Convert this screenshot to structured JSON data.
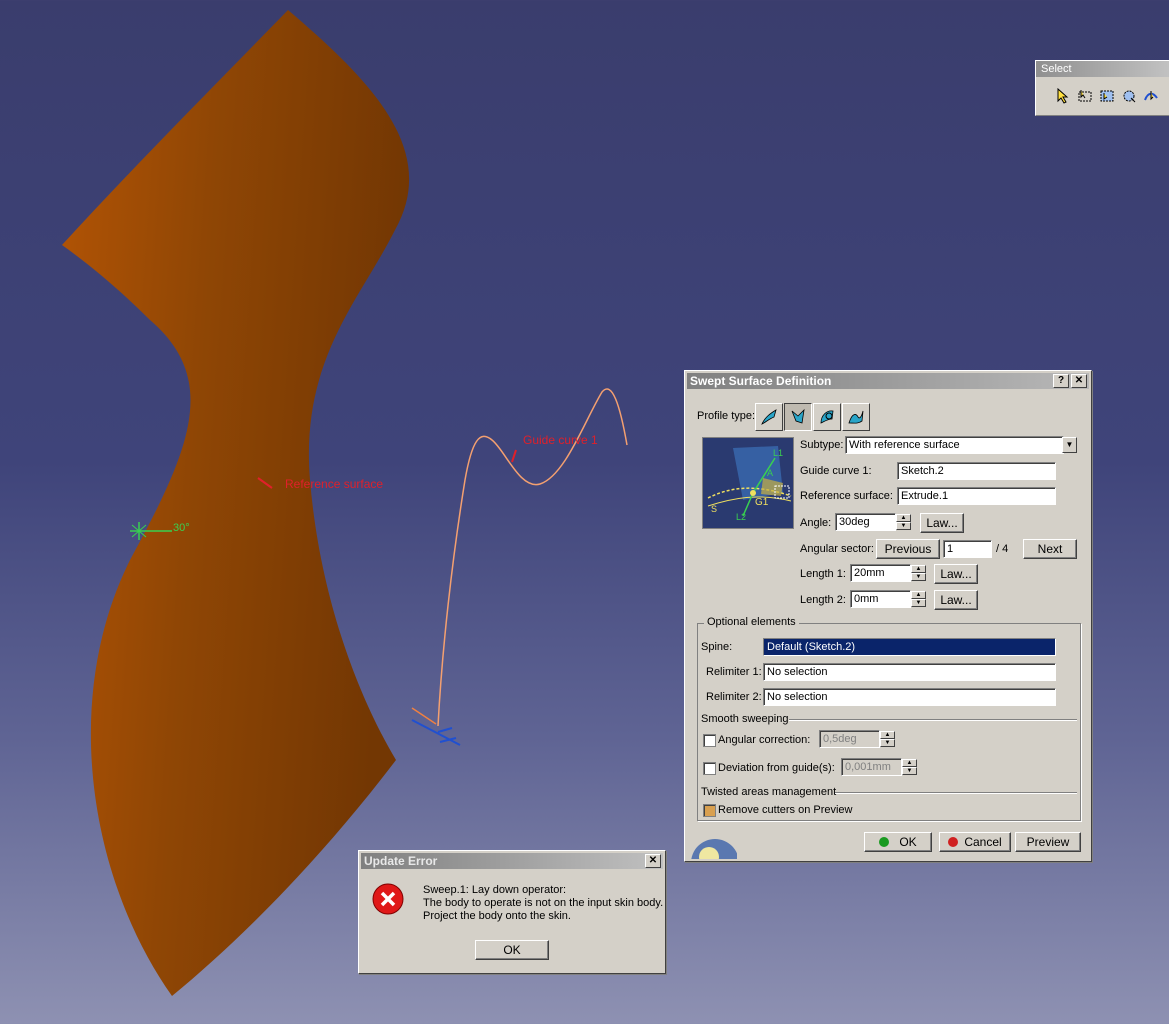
{
  "viewport": {
    "labels": {
      "reference_surface": "Reference surface",
      "guide_curve": "Guide curve 1",
      "angle": "30°"
    },
    "colors": {
      "surface": "#9a4c05",
      "curve": "#f4a070",
      "label": "#e0202a"
    }
  },
  "toolbar": {
    "title": "Select",
    "icons": [
      "select-arrow-icon",
      "select-trap-icon",
      "select-intersect-icon",
      "select-lasso-icon",
      "select-paint-icon"
    ]
  },
  "swept_dialog": {
    "title": "Swept Surface Definition",
    "profile_type_label": "Profile type:",
    "subtype_label": "Subtype:",
    "subtype_value": "With reference surface",
    "guide_curve_label": "Guide curve 1:",
    "guide_curve_value": "Sketch.2",
    "reference_surface_label": "Reference surface:",
    "reference_surface_value": "Extrude.1",
    "angle_label": "Angle:",
    "angle_value": "30deg",
    "law_label": "Law...",
    "angular_sector_label": "Angular sector:",
    "previous_label": "Previous",
    "sector_value": "1",
    "sector_total": "/ 4",
    "next_label": "Next",
    "length1_label": "Length 1:",
    "length1_value": "20mm",
    "length2_label": "Length 2:",
    "length2_value": "0mm",
    "optional_label": "Optional elements",
    "spine_label": "Spine:",
    "spine_value": "Default (Sketch.2)",
    "relimiter1_label": "Relimiter 1:",
    "relimiter1_value": "No selection",
    "relimiter2_label": "Relimiter 2:",
    "relimiter2_value": "No selection",
    "smooth_label": "Smooth sweeping",
    "angular_correction_label": "Angular correction:",
    "angular_correction_value": "0,5deg",
    "deviation_label": "Deviation from guide(s):",
    "deviation_value": "0,001mm",
    "twisted_label": "Twisted areas management",
    "remove_cutters_label": "Remove cutters on Preview",
    "ok_label": "OK",
    "cancel_label": "Cancel",
    "preview_label": "Preview",
    "diagram_labels": {
      "l1": "L1",
      "a": "A",
      "g1": "G1",
      "s": "S",
      "l2": "L2"
    }
  },
  "error_dialog": {
    "title": "Update Error",
    "line1": "Sweep.1: Lay down operator:",
    "line2": "The body to operate is not on the input skin body.",
    "line3": "Project the body onto the skin.",
    "ok_label": "OK"
  }
}
